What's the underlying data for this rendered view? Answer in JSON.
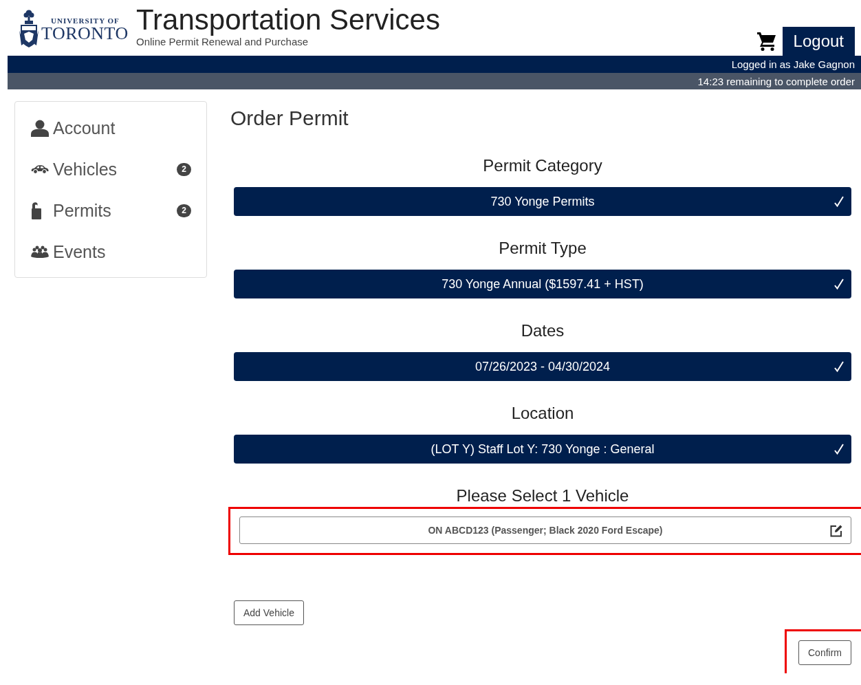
{
  "header": {
    "logo": {
      "line_1": "UNIVERSITY OF",
      "line_2": "TORONTO"
    },
    "title": "Transportation Services",
    "subtitle": "Online Permit Renewal and Purchase",
    "logout": "Logout",
    "logged_in": "Logged in as Jake Gagnon",
    "timer": "14:23 remaining to complete order"
  },
  "sidebar": {
    "items": [
      {
        "kind": "person",
        "label": "Account"
      },
      {
        "kind": "car",
        "label": "Vehicles",
        "badge": "2"
      },
      {
        "kind": "hanger",
        "label": "Permits",
        "badge": "2"
      },
      {
        "kind": "people",
        "label": "Events"
      }
    ]
  },
  "page_title": "Order Permit",
  "sections": [
    {
      "heading": "Permit Category",
      "value": "730 Yonge Permits",
      "confirmed": true
    },
    {
      "heading": "Permit Type",
      "value": "730 Yonge Annual ($1597.41 + HST)",
      "confirmed": true
    },
    {
      "heading": "Dates",
      "value": "07/26/2023 - 04/30/2024",
      "confirmed": true
    },
    {
      "heading": "Location",
      "value": "(LOT Y) Staff Lot Y: 730 Yonge : General",
      "confirmed": true
    }
  ],
  "vehicle_section": {
    "heading": "Please Select 1 Vehicle",
    "highlighted": true,
    "vehicles": [
      {
        "label": "ON ABCD123 (Passenger; Black 2020 Ford Escape)"
      }
    ]
  },
  "add_vehicle_button": "Add Vehicle",
  "confirm_button": {
    "label": "Confirm",
    "highlighted": true
  }
}
